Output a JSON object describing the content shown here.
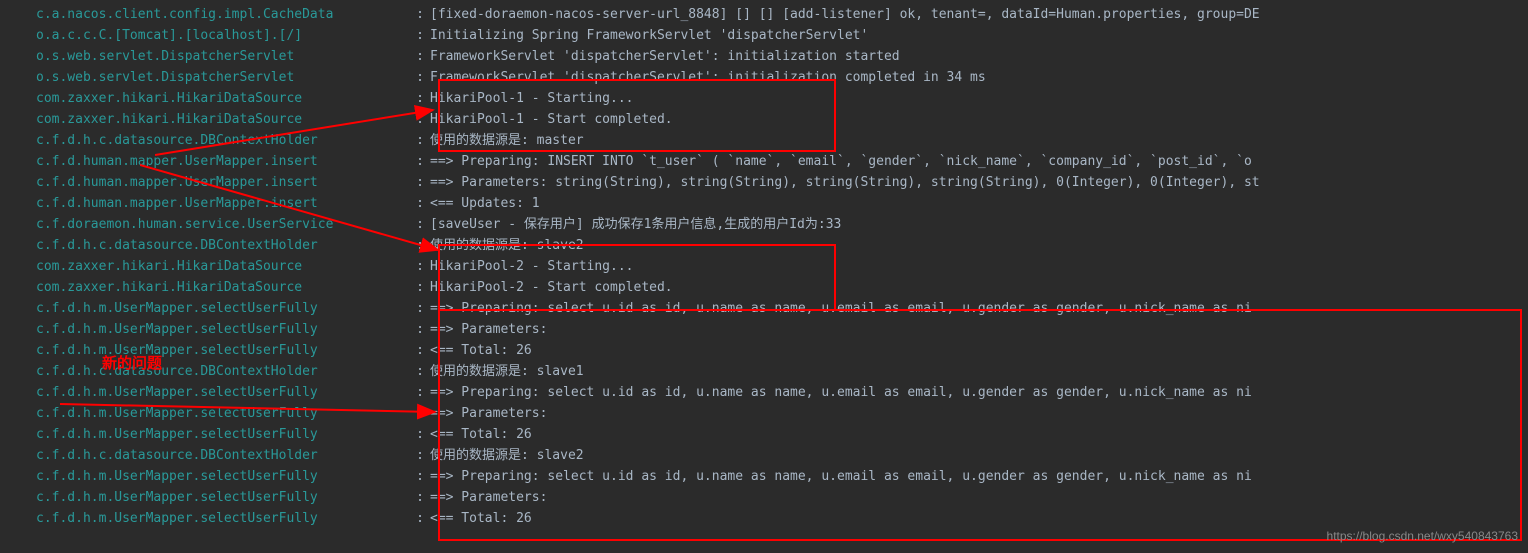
{
  "lines": [
    {
      "logger": "c.a.nacos.client.config.impl.CacheData",
      "msg": "[fixed-doraemon-nacos-server-url_8848] [] [] [add-listener] ok, tenant=, dataId=Human.properties, group=DE"
    },
    {
      "logger": "o.a.c.c.C.[Tomcat].[localhost].[/]",
      "msg": "Initializing Spring FrameworkServlet 'dispatcherServlet'"
    },
    {
      "logger": "o.s.web.servlet.DispatcherServlet",
      "msg": "FrameworkServlet 'dispatcherServlet': initialization started"
    },
    {
      "logger": "o.s.web.servlet.DispatcherServlet",
      "msg": "FrameworkServlet 'dispatcherServlet': initialization completed in 34 ms"
    },
    {
      "logger": "com.zaxxer.hikari.HikariDataSource",
      "msg": "HikariPool-1 - Starting..."
    },
    {
      "logger": "com.zaxxer.hikari.HikariDataSource",
      "msg": "HikariPool-1 - Start completed."
    },
    {
      "logger": "c.f.d.h.c.datasource.DBContextHolder",
      "msg": "使用的数据源是: master"
    },
    {
      "logger": "c.f.d.human.mapper.UserMapper.insert",
      "msg": "==>  Preparing: INSERT INTO `t_user` ( `name`, `email`, `gender`, `nick_name`, `company_id`, `post_id`, `o"
    },
    {
      "logger": "c.f.d.human.mapper.UserMapper.insert",
      "msg": "==> Parameters: string(String), string(String), string(String), string(String), 0(Integer), 0(Integer), st"
    },
    {
      "logger": "c.f.d.human.mapper.UserMapper.insert",
      "msg": "<==    Updates: 1"
    },
    {
      "logger": "c.f.doraemon.human.service.UserService",
      "msg": "[saveUser - 保存用户] 成功保存1条用户信息,生成的用户Id为:33"
    },
    {
      "logger": "c.f.d.h.c.datasource.DBContextHolder",
      "msg": "使用的数据源是: slave2"
    },
    {
      "logger": "com.zaxxer.hikari.HikariDataSource",
      "msg": "HikariPool-2 - Starting..."
    },
    {
      "logger": "com.zaxxer.hikari.HikariDataSource",
      "msg": "HikariPool-2 - Start completed."
    },
    {
      "logger": "c.f.d.h.m.UserMapper.selectUserFully",
      "msg": "==>  Preparing: select u.id as id, u.name as name, u.email as email, u.gender as gender, u.nick_name as ni"
    },
    {
      "logger": "c.f.d.h.m.UserMapper.selectUserFully",
      "msg": "==> Parameters: "
    },
    {
      "logger": "c.f.d.h.m.UserMapper.selectUserFully",
      "msg": "<==      Total: 26"
    },
    {
      "logger": "c.f.d.h.c.datasource.DBContextHolder",
      "msg": "使用的数据源是: slave1"
    },
    {
      "logger": "c.f.d.h.m.UserMapper.selectUserFully",
      "msg": "==>  Preparing: select u.id as id, u.name as name, u.email as email, u.gender as gender, u.nick_name as ni"
    },
    {
      "logger": "c.f.d.h.m.UserMapper.selectUserFully",
      "msg": "==> Parameters: "
    },
    {
      "logger": "c.f.d.h.m.UserMapper.selectUserFully",
      "msg": "<==      Total: 26"
    },
    {
      "logger": "c.f.d.h.c.datasource.DBContextHolder",
      "msg": "使用的数据源是: slave2"
    },
    {
      "logger": "c.f.d.h.m.UserMapper.selectUserFully",
      "msg": "==>  Preparing: select u.id as id, u.name as name, u.email as email, u.gender as gender, u.nick_name as ni"
    },
    {
      "logger": "c.f.d.h.m.UserMapper.selectUserFully",
      "msg": "==> Parameters: "
    },
    {
      "logger": "c.f.d.h.m.UserMapper.selectUserFully",
      "msg": "<==      Total: 26"
    }
  ],
  "annotations": {
    "label": "新的问题"
  },
  "watermark": "https://blog.csdn.net/wxy540843763"
}
